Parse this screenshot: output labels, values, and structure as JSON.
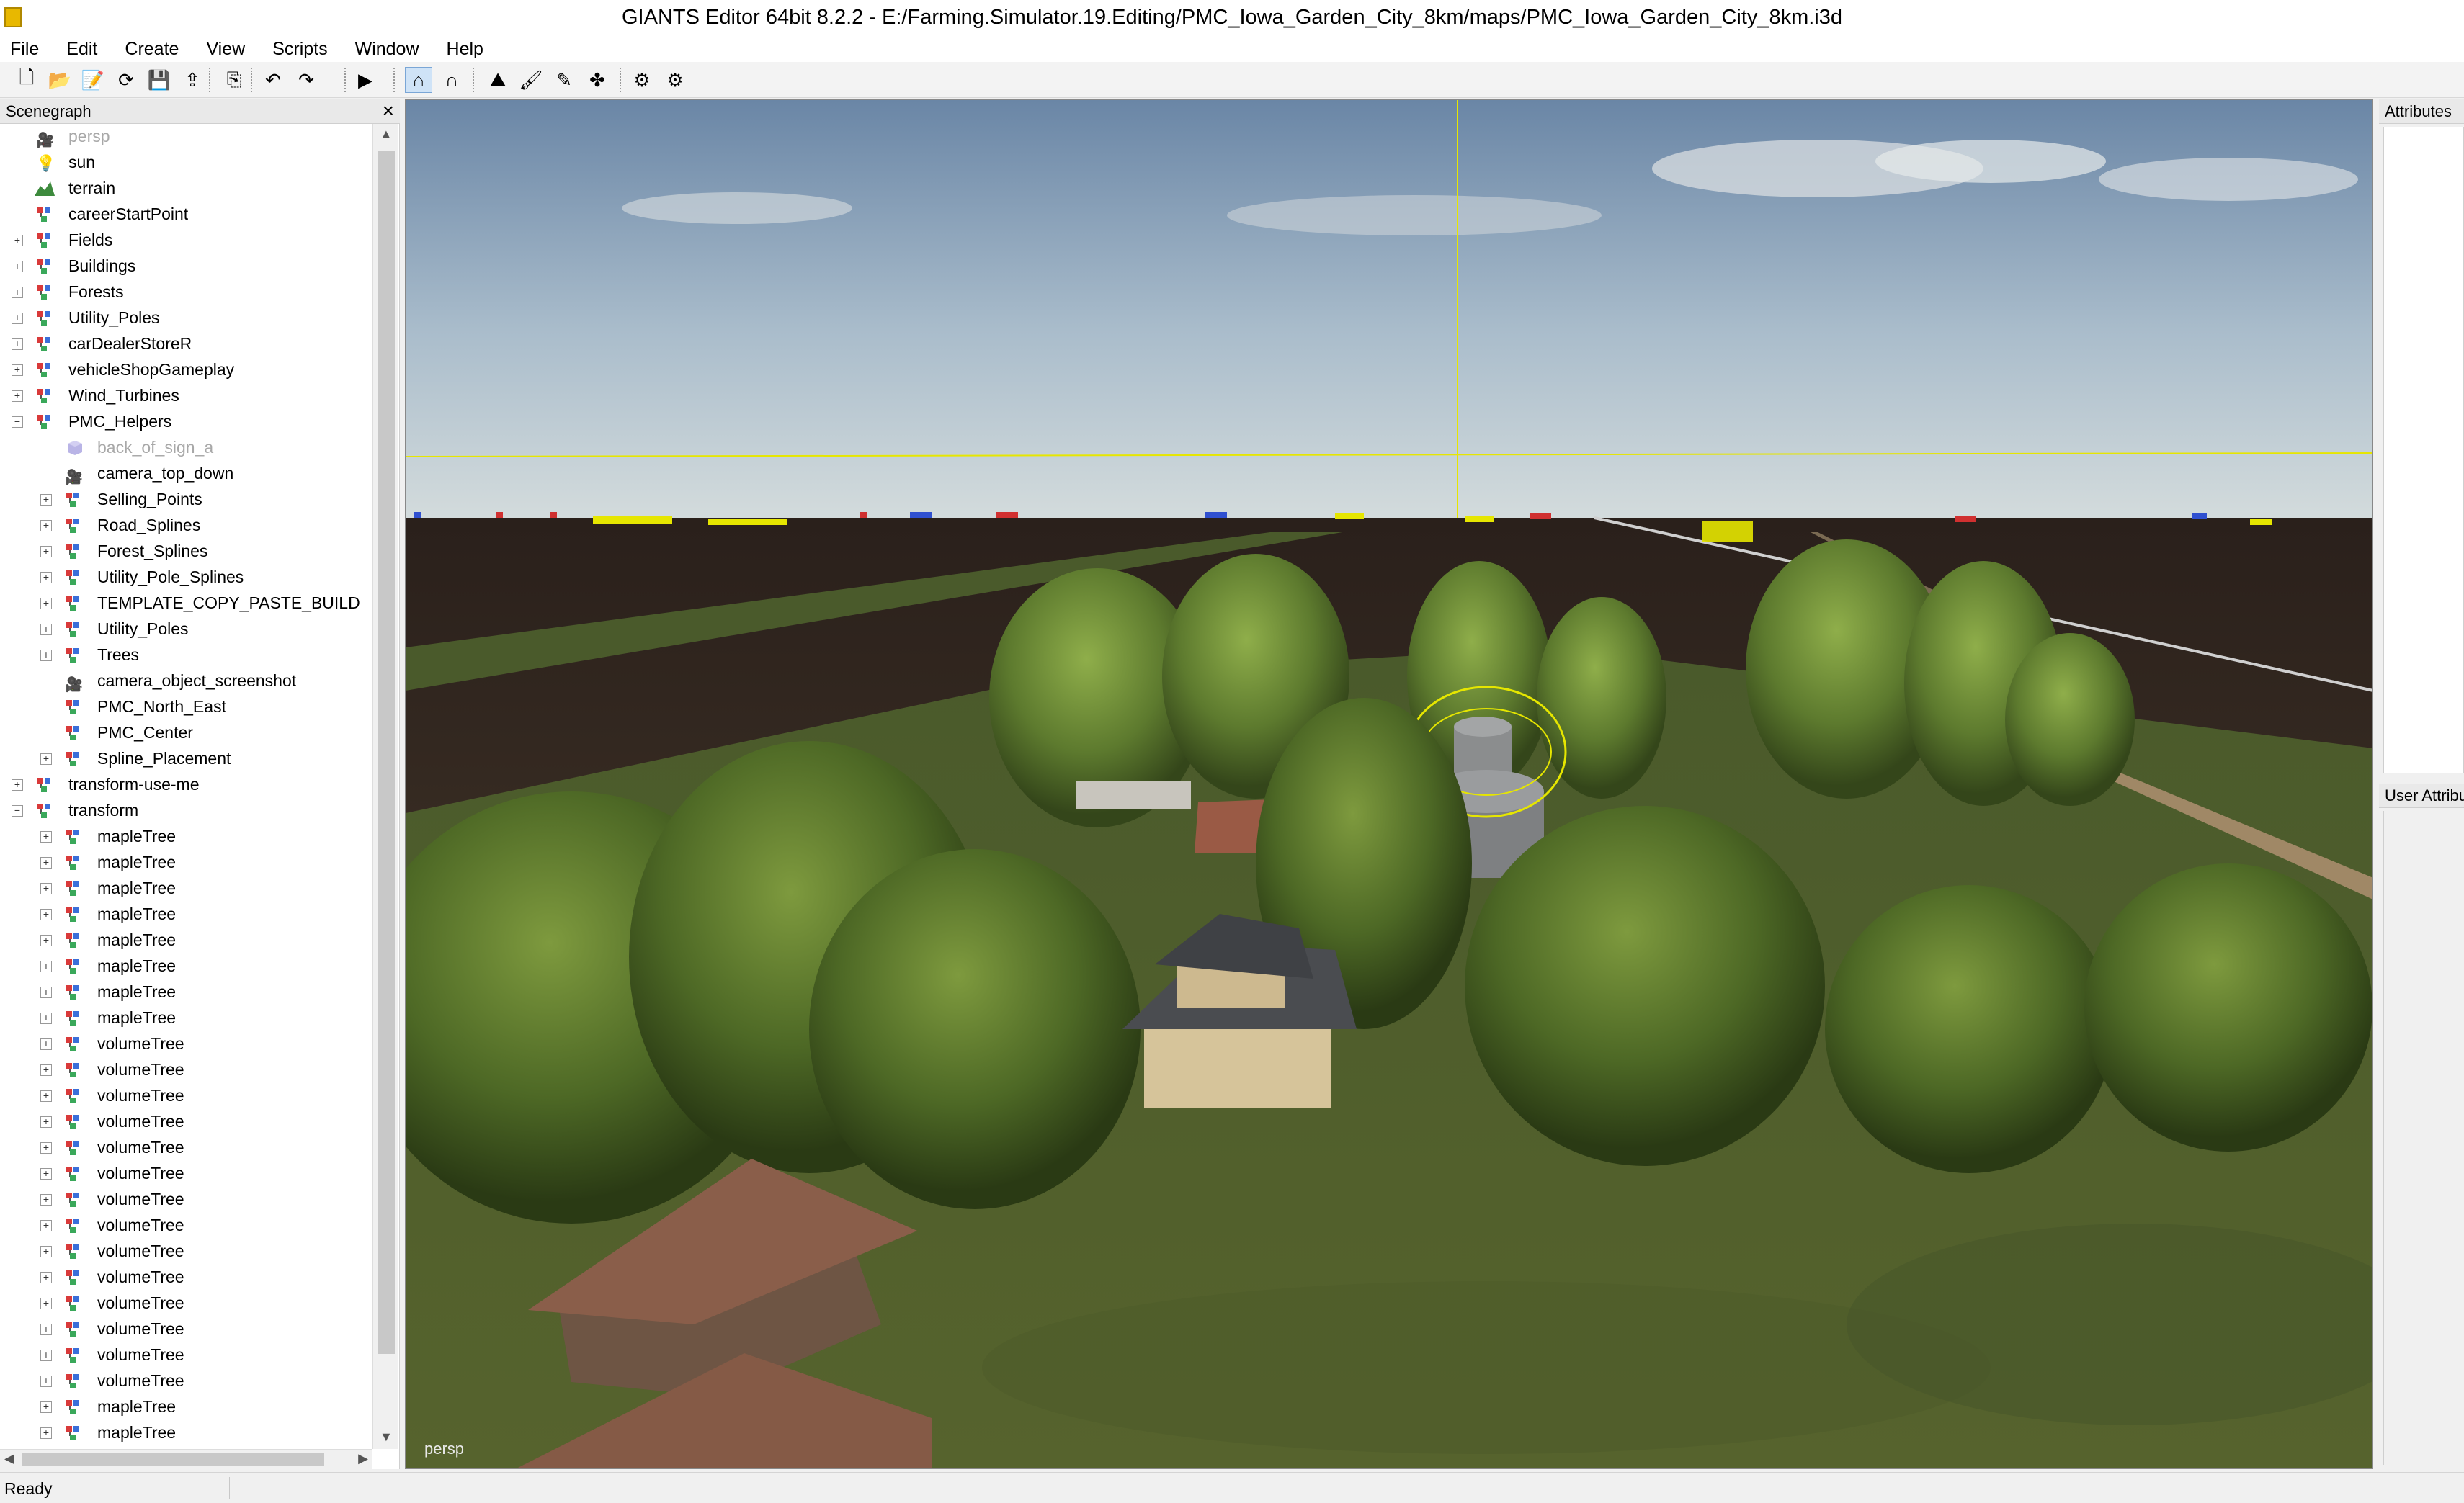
{
  "window": {
    "title": "GIANTS Editor 64bit 8.2.2 - E:/Farming.Simulator.19.Editing/PMC_Iowa_Garden_City_8km/maps/PMC_Iowa_Garden_City_8km.i3d"
  },
  "menu": [
    "File",
    "Edit",
    "Create",
    "View",
    "Scripts",
    "Window",
    "Help"
  ],
  "toolbar": [
    {
      "name": "new-icon",
      "glyph": "🗋"
    },
    {
      "name": "open-icon",
      "glyph": "📂"
    },
    {
      "name": "edit-file-icon",
      "glyph": "📝"
    },
    {
      "name": "reload-icon",
      "glyph": "⟳"
    },
    {
      "name": "save-icon",
      "glyph": "💾"
    },
    {
      "name": "export-icon",
      "glyph": "⇪"
    },
    {
      "name": "import-icon",
      "glyph": "⎘"
    },
    {
      "name": "undo-icon",
      "glyph": "↶"
    },
    {
      "name": "redo-icon",
      "glyph": "↷"
    },
    {
      "name": "play-icon",
      "glyph": "▶"
    },
    {
      "name": "select-mode-icon",
      "glyph": "⌂"
    },
    {
      "name": "magnet-icon",
      "glyph": "∩"
    },
    {
      "name": "terrain-sculpt-icon",
      "glyph": "⛰"
    },
    {
      "name": "terrain-paint-icon",
      "glyph": "🖌"
    },
    {
      "name": "foliage-paint-icon",
      "glyph": "✎"
    },
    {
      "name": "tree-place-icon",
      "glyph": "✤"
    },
    {
      "name": "refresh-shaders-icon",
      "glyph": "⚙"
    },
    {
      "name": "settings-icon",
      "glyph": "⚙"
    }
  ],
  "scenegraph": {
    "title": "Scenegraph",
    "close": "×",
    "items": [
      {
        "label": "persp",
        "depth": 0,
        "icon": "camera",
        "expander": "",
        "dim": true
      },
      {
        "label": "sun",
        "depth": 0,
        "icon": "light",
        "expander": "",
        "dim": false
      },
      {
        "label": "terrain",
        "depth": 0,
        "icon": "terrain",
        "expander": "",
        "dim": false
      },
      {
        "label": "careerStartPoint",
        "depth": 0,
        "icon": "node",
        "expander": "",
        "dim": false
      },
      {
        "label": "Fields",
        "depth": 0,
        "icon": "node",
        "expander": "+",
        "dim": false
      },
      {
        "label": "Buildings",
        "depth": 0,
        "icon": "node",
        "expander": "+",
        "dim": false
      },
      {
        "label": "Forests",
        "depth": 0,
        "icon": "node",
        "expander": "+",
        "dim": false
      },
      {
        "label": "Utility_Poles",
        "depth": 0,
        "icon": "node",
        "expander": "+",
        "dim": false
      },
      {
        "label": "carDealerStoreR",
        "depth": 0,
        "icon": "node",
        "expander": "+",
        "dim": false
      },
      {
        "label": "vehicleShopGameplay",
        "depth": 0,
        "icon": "node",
        "expander": "+",
        "dim": false
      },
      {
        "label": "Wind_Turbines",
        "depth": 0,
        "icon": "node",
        "expander": "+",
        "dim": false
      },
      {
        "label": "PMC_Helpers",
        "depth": 0,
        "icon": "node",
        "expander": "−",
        "dim": false
      },
      {
        "label": "back_of_sign_a",
        "depth": 1,
        "icon": "cube",
        "expander": "",
        "dim": true
      },
      {
        "label": "camera_top_down",
        "depth": 1,
        "icon": "camera",
        "expander": "",
        "dim": false
      },
      {
        "label": "Selling_Points",
        "depth": 1,
        "icon": "node",
        "expander": "+",
        "dim": false
      },
      {
        "label": "Road_Splines",
        "depth": 1,
        "icon": "node",
        "expander": "+",
        "dim": false
      },
      {
        "label": "Forest_Splines",
        "depth": 1,
        "icon": "node",
        "expander": "+",
        "dim": false
      },
      {
        "label": "Utility_Pole_Splines",
        "depth": 1,
        "icon": "node",
        "expander": "+",
        "dim": false
      },
      {
        "label": "TEMPLATE_COPY_PASTE_BUILD",
        "depth": 1,
        "icon": "node",
        "expander": "+",
        "dim": false
      },
      {
        "label": "Utility_Poles",
        "depth": 1,
        "icon": "node",
        "expander": "+",
        "dim": false
      },
      {
        "label": "Trees",
        "depth": 1,
        "icon": "node",
        "expander": "+",
        "dim": false
      },
      {
        "label": "camera_object_screenshot",
        "depth": 1,
        "icon": "camera",
        "expander": "",
        "dim": false
      },
      {
        "label": "PMC_North_East",
        "depth": 1,
        "icon": "node",
        "expander": "",
        "dim": false
      },
      {
        "label": "PMC_Center",
        "depth": 1,
        "icon": "node",
        "expander": "",
        "dim": false
      },
      {
        "label": "Spline_Placement",
        "depth": 1,
        "icon": "node",
        "expander": "+",
        "dim": false
      },
      {
        "label": "transform-use-me",
        "depth": 0,
        "icon": "node",
        "expander": "+",
        "dim": false
      },
      {
        "label": "transform",
        "depth": 0,
        "icon": "node",
        "expander": "−",
        "dim": false
      },
      {
        "label": "mapleTree",
        "depth": 1,
        "icon": "node",
        "expander": "+",
        "dim": false
      },
      {
        "label": "mapleTree",
        "depth": 1,
        "icon": "node",
        "expander": "+",
        "dim": false
      },
      {
        "label": "mapleTree",
        "depth": 1,
        "icon": "node",
        "expander": "+",
        "dim": false
      },
      {
        "label": "mapleTree",
        "depth": 1,
        "icon": "node",
        "expander": "+",
        "dim": false
      },
      {
        "label": "mapleTree",
        "depth": 1,
        "icon": "node",
        "expander": "+",
        "dim": false
      },
      {
        "label": "mapleTree",
        "depth": 1,
        "icon": "node",
        "expander": "+",
        "dim": false
      },
      {
        "label": "mapleTree",
        "depth": 1,
        "icon": "node",
        "expander": "+",
        "dim": false
      },
      {
        "label": "mapleTree",
        "depth": 1,
        "icon": "node",
        "expander": "+",
        "dim": false
      },
      {
        "label": "volumeTree",
        "depth": 1,
        "icon": "node",
        "expander": "+",
        "dim": false
      },
      {
        "label": "volumeTree",
        "depth": 1,
        "icon": "node",
        "expander": "+",
        "dim": false
      },
      {
        "label": "volumeTree",
        "depth": 1,
        "icon": "node",
        "expander": "+",
        "dim": false
      },
      {
        "label": "volumeTree",
        "depth": 1,
        "icon": "node",
        "expander": "+",
        "dim": false
      },
      {
        "label": "volumeTree",
        "depth": 1,
        "icon": "node",
        "expander": "+",
        "dim": false
      },
      {
        "label": "volumeTree",
        "depth": 1,
        "icon": "node",
        "expander": "+",
        "dim": false
      },
      {
        "label": "volumeTree",
        "depth": 1,
        "icon": "node",
        "expander": "+",
        "dim": false
      },
      {
        "label": "volumeTree",
        "depth": 1,
        "icon": "node",
        "expander": "+",
        "dim": false
      },
      {
        "label": "volumeTree",
        "depth": 1,
        "icon": "node",
        "expander": "+",
        "dim": false
      },
      {
        "label": "volumeTree",
        "depth": 1,
        "icon": "node",
        "expander": "+",
        "dim": false
      },
      {
        "label": "volumeTree",
        "depth": 1,
        "icon": "node",
        "expander": "+",
        "dim": false
      },
      {
        "label": "volumeTree",
        "depth": 1,
        "icon": "node",
        "expander": "+",
        "dim": false
      },
      {
        "label": "volumeTree",
        "depth": 1,
        "icon": "node",
        "expander": "+",
        "dim": false
      },
      {
        "label": "volumeTree",
        "depth": 1,
        "icon": "node",
        "expander": "+",
        "dim": false
      },
      {
        "label": "mapleTree",
        "depth": 1,
        "icon": "node",
        "expander": "+",
        "dim": false
      },
      {
        "label": "mapleTree",
        "depth": 1,
        "icon": "node",
        "expander": "+",
        "dim": false
      },
      {
        "label": "mapleTree",
        "depth": 1,
        "icon": "node",
        "expander": "+",
        "dim": false
      }
    ]
  },
  "viewport": {
    "camera_label": "persp"
  },
  "attributes": {
    "title": "Attributes",
    "user_title": "User Attributes"
  },
  "status": {
    "text": "Ready"
  },
  "colors": {
    "sky_top": "#6f8aa8",
    "sky_bottom": "#c9d5da",
    "field_dark": "#2d221c",
    "grass": "#4d5a2a",
    "tree_green": "#5d7a2e",
    "highlight_yellow": "#e6e600"
  }
}
